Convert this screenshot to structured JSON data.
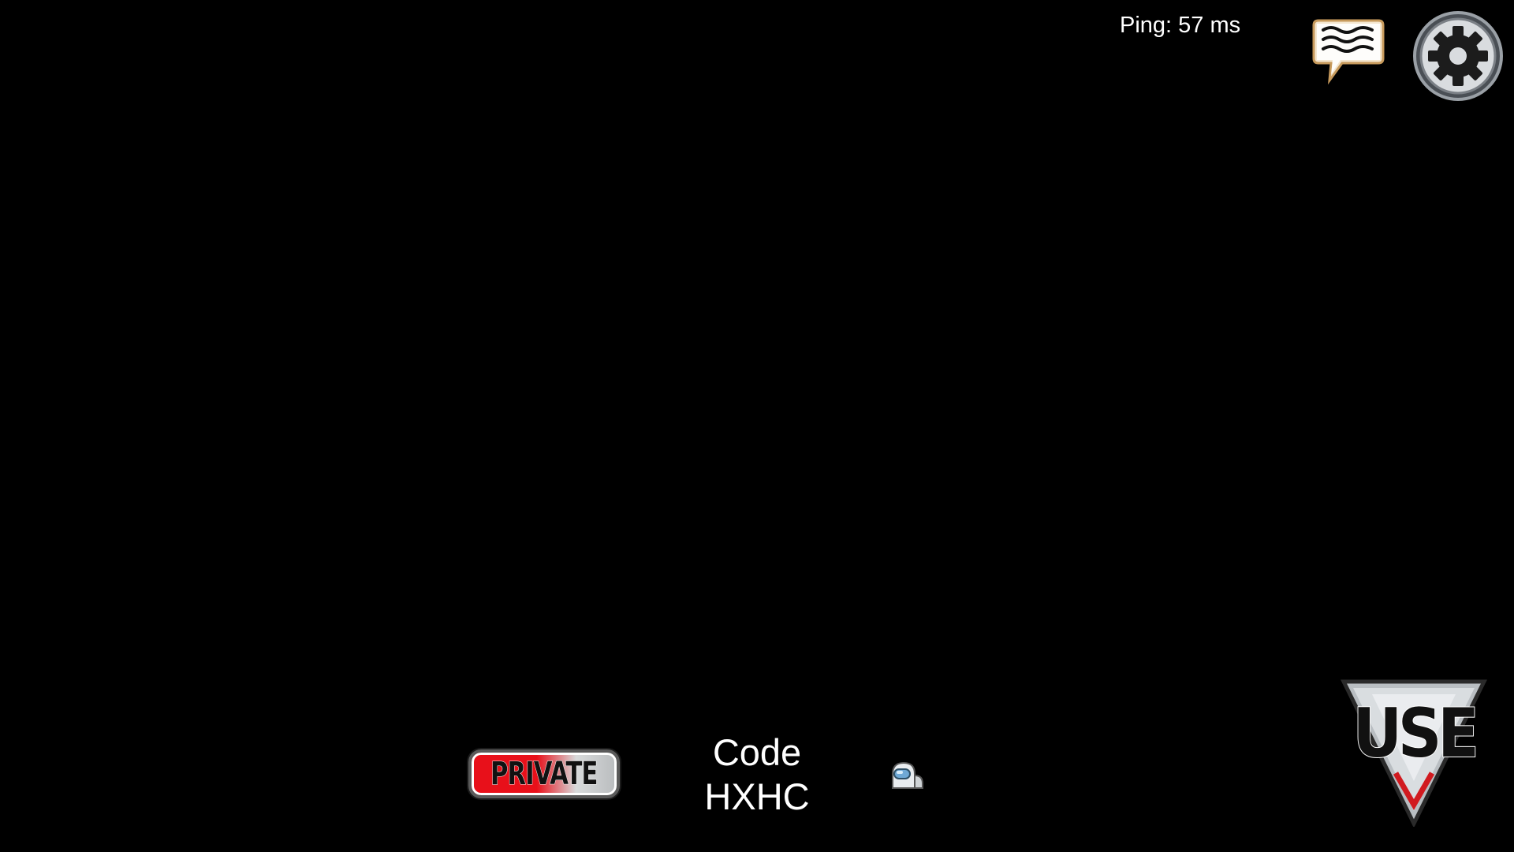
{
  "hud": {
    "ping_text": "Ping: 57 ms"
  },
  "lobby": {
    "privacy_label": "PRIVATE",
    "code_label": "Code",
    "code_value": "HXHC"
  },
  "actions": {
    "use_label": "USE"
  },
  "icons": {
    "chat": "chat-bubble-icon",
    "settings": "gear-icon",
    "player": "crewmate-icon"
  },
  "colors": {
    "background": "#000000",
    "private_red": "#e8101a",
    "text": "#ffffff"
  }
}
